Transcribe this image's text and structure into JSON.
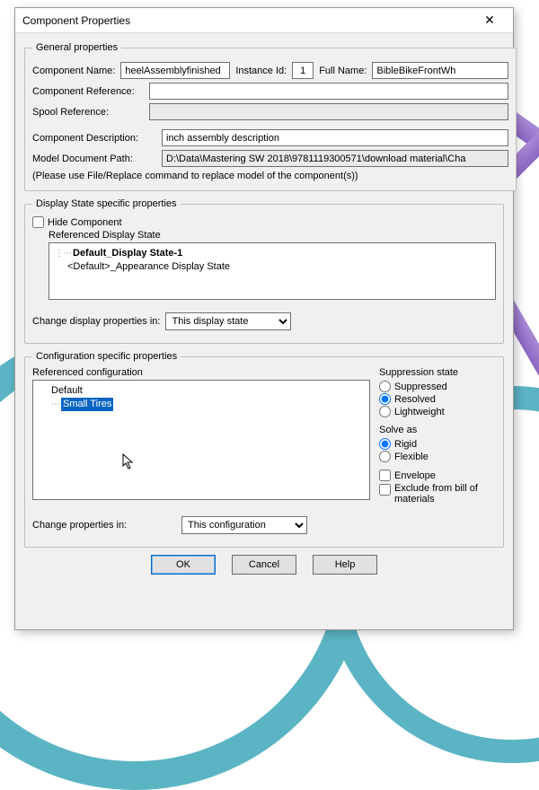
{
  "dialog": {
    "title": "Component Properties",
    "close_glyph": "✕"
  },
  "general": {
    "legend": "General properties",
    "component_name_label": "Component Name:",
    "component_name": "heelAssemblyfinished",
    "instance_id_label": "Instance Id:",
    "instance_id": "1",
    "full_name_label": "Full Name:",
    "full_name": "BibleBikeFrontWh",
    "component_reference_label": "Component Reference:",
    "component_reference": "",
    "spool_reference_label": "Spool Reference:",
    "spool_reference": "",
    "component_description_label": "Component Description:",
    "component_description": "inch assembly description",
    "model_path_label": "Model Document Path:",
    "model_path": "D:\\Data\\Mastering SW 2018\\9781119300571\\download material\\Cha",
    "note": "(Please use File/Replace command to replace model of the component(s))"
  },
  "display": {
    "legend": "Display State specific properties",
    "hide_label": "Hide Component",
    "ref_display_state_label": "Referenced Display State",
    "states": {
      "0": "Default_Display State-1",
      "1": "<Default>_Appearance Display State"
    },
    "change_in_label": "Change display properties in:",
    "change_in_options": {
      "0": "This display state"
    }
  },
  "config": {
    "legend": "Configuration specific properties",
    "ref_config_label": "Referenced configuration",
    "items": {
      "0": "Default",
      "1": "Small Tires"
    },
    "change_props_label": "Change properties in:",
    "change_props_options": {
      "0": "This configuration"
    },
    "suppression": {
      "title": "Suppression state",
      "suppressed": "Suppressed",
      "resolved": "Resolved",
      "lightweight": "Lightweight"
    },
    "solve_as": {
      "title": "Solve as",
      "rigid": "Rigid",
      "flexible": "Flexible"
    },
    "envelope_label": "Envelope",
    "exclude_bom_label": "Exclude from bill of materials"
  },
  "buttons": {
    "ok": "OK",
    "cancel": "Cancel",
    "help": "Help"
  }
}
